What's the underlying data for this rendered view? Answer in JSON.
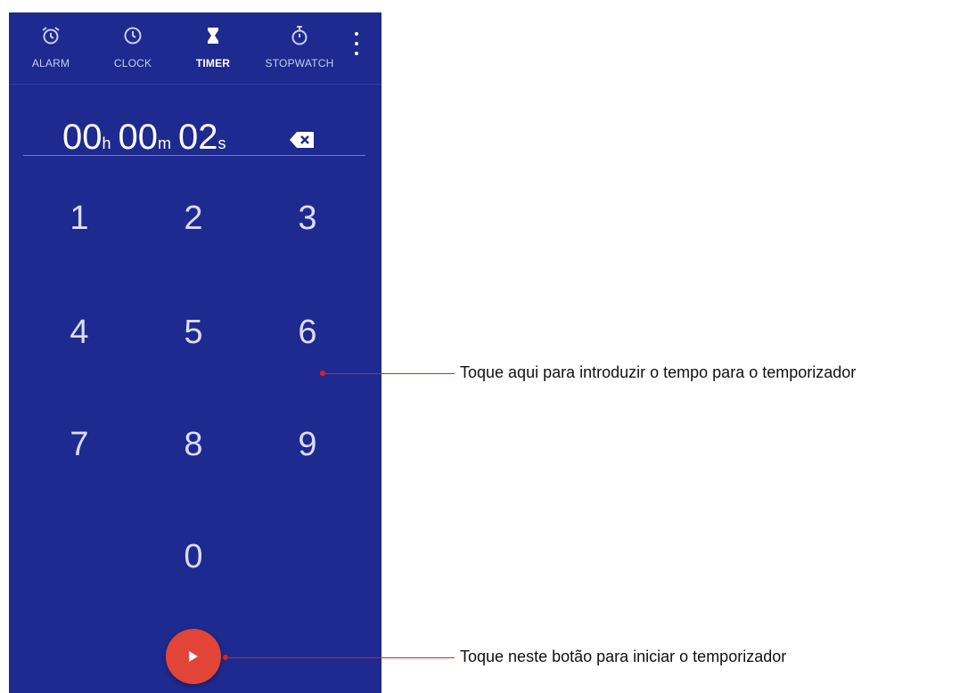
{
  "tabs": [
    {
      "label": "ALARM",
      "icon": "alarm-icon"
    },
    {
      "label": "CLOCK",
      "icon": "clock-icon"
    },
    {
      "label": "TIMER",
      "icon": "hourglass-icon"
    },
    {
      "label": "STOPWATCH",
      "icon": "stopwatch-icon"
    }
  ],
  "active_tab": "TIMER",
  "timer": {
    "hours": "00",
    "hours_unit": "h",
    "minutes": "00",
    "minutes_unit": "m",
    "seconds": "02",
    "seconds_unit": "s"
  },
  "keypad": [
    "1",
    "2",
    "3",
    "4",
    "5",
    "6",
    "7",
    "8",
    "9",
    "0"
  ],
  "callouts": {
    "keypad": "Toque aqui para introduzir o tempo para o temporizador",
    "start": "Toque neste botão para iniciar o temporizador"
  },
  "colors": {
    "background": "#1e2a8f",
    "accent": "#e34438",
    "callout": "#e02020"
  }
}
